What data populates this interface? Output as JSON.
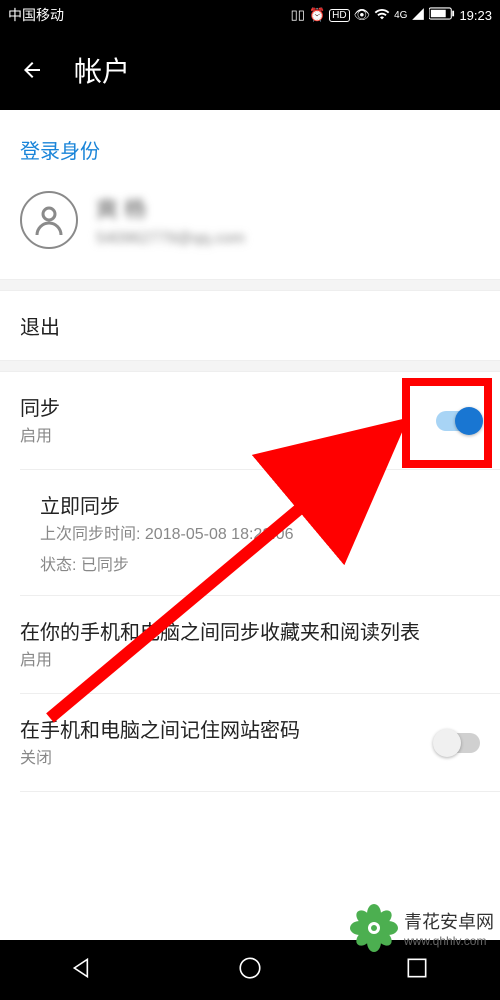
{
  "status": {
    "carrier": "中国移动",
    "time": "19:23",
    "network_badge": "HD",
    "signal_badge": "4G"
  },
  "header": {
    "title": "帐户"
  },
  "login_label": "登录身份",
  "profile": {
    "name": "爽 杨",
    "email": "540962779@qq.com"
  },
  "logout": {
    "label": "退出"
  },
  "sync": {
    "title": "同步",
    "subtitle": "启用",
    "toggle_on": true
  },
  "sync_now": {
    "title": "立即同步",
    "line1": "上次同步时间: 2018-05-08 18:22:06",
    "line2": "状态: 已同步"
  },
  "sync_favs": {
    "title": "在你的手机和电脑之间同步收藏夹和阅读列表",
    "subtitle": "启用"
  },
  "remember_pwd": {
    "title": "在手机和电脑之间记住网站密码",
    "subtitle": "关闭",
    "toggle_on": false
  },
  "watermark": {
    "name": "青花安卓网",
    "url": "www.qhhlv.com"
  }
}
